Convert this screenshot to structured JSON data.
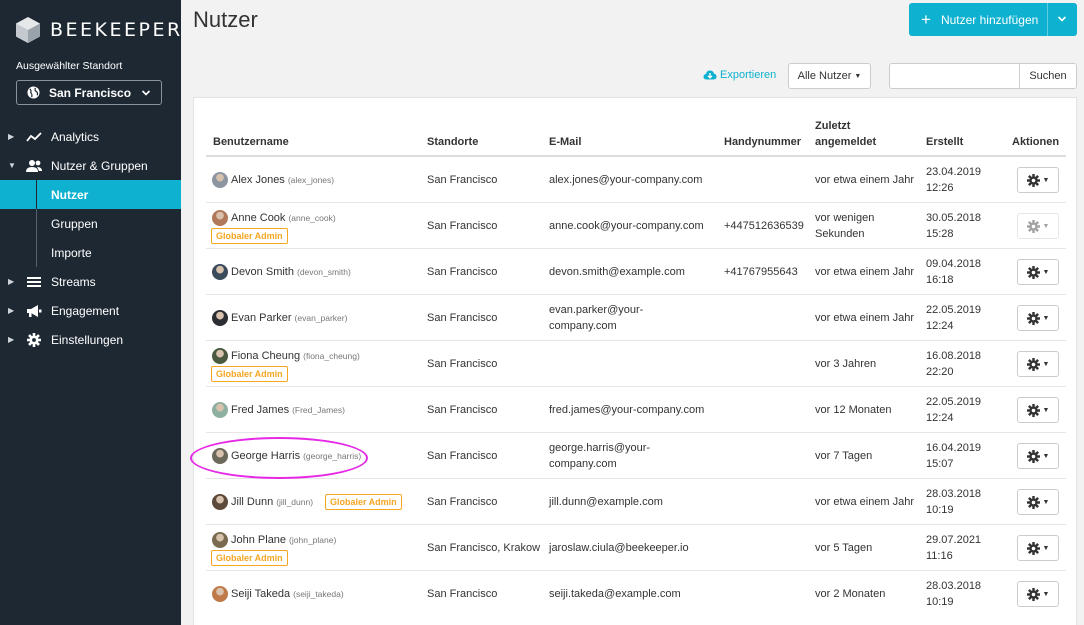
{
  "sidebar": {
    "logo_text": "BEEKEEPER",
    "location_label": "Ausgewählter Standort",
    "location_value": "San Francisco",
    "nav": {
      "analytics": "Analytics",
      "users_groups": "Nutzer & Gruppen",
      "users": "Nutzer",
      "groups": "Gruppen",
      "imports": "Importe",
      "streams": "Streams",
      "engagement": "Engagement",
      "settings": "Einstellungen"
    },
    "accent_color": "#0eb1cf",
    "background_color": "#1e2833"
  },
  "header": {
    "title": "Nutzer",
    "add_button": "Nutzer hinzufügen",
    "export": "Exportieren",
    "filter": "Alle Nutzer",
    "search_placeholder": "",
    "search_button": "Suchen"
  },
  "table": {
    "columns": {
      "username": "Benutzername",
      "locations": "Standorte",
      "email": "E-Mail",
      "phone": "Handynummer",
      "last_login_1": "Zuletzt",
      "last_login_2": "angemeldet",
      "created": "Erstellt",
      "actions": "Aktionen"
    },
    "admin_badge": "Globaler Admin",
    "rows": [
      {
        "name": "Alex Jones",
        "username": "(alex_jones)",
        "admin": false,
        "location": "San Francisco",
        "email1": "alex.jones@your-company.com",
        "email2": "",
        "phone": "",
        "last1": "vor etwa einem Jahr",
        "last2": "",
        "date": "23.04.2019",
        "time": "12:26",
        "gear_disabled": false
      },
      {
        "name": "Anne Cook",
        "username": "(anne_cook)",
        "admin": true,
        "location": "San Francisco",
        "email1": "anne.cook@your-company.com",
        "email2": "",
        "phone": "+447512636539",
        "last1": "vor wenigen",
        "last2": "Sekunden",
        "date": "30.05.2018",
        "time": "15:28",
        "gear_disabled": true
      },
      {
        "name": "Devon Smith",
        "username": "(devon_smith)",
        "admin": false,
        "location": "San Francisco",
        "email1": "devon.smith@example.com",
        "email2": "",
        "phone": "+41767955643",
        "last1": "vor etwa einem Jahr",
        "last2": "",
        "date": "09.04.2018",
        "time": "16:18",
        "gear_disabled": false
      },
      {
        "name": "Evan Parker",
        "username": "(evan_parker)",
        "admin": false,
        "location": "San Francisco",
        "email1": "evan.parker@your-",
        "email2": "company.com",
        "phone": "",
        "last1": "vor etwa einem Jahr",
        "last2": "",
        "date": "22.05.2019",
        "time": "12:24",
        "gear_disabled": false
      },
      {
        "name": "Fiona Cheung",
        "username": "(fiona_cheung)",
        "admin": true,
        "location": "San Francisco",
        "email1": "",
        "email2": "",
        "phone": "",
        "last1": "vor 3 Jahren",
        "last2": "",
        "date": "16.08.2018",
        "time": "22:20",
        "gear_disabled": false
      },
      {
        "name": "Fred James",
        "username": "(Fred_James)",
        "admin": false,
        "location": "San Francisco",
        "email1": "fred.james@your-company.com",
        "email2": "",
        "phone": "",
        "last1": "vor 12 Monaten",
        "last2": "",
        "date": "22.05.2019",
        "time": "12:24",
        "gear_disabled": false
      },
      {
        "name": "George Harris",
        "username": "(george_harris)",
        "admin": false,
        "location": "San Francisco",
        "email1": "george.harris@your-",
        "email2": "company.com",
        "phone": "",
        "last1": "vor 7 Tagen",
        "last2": "",
        "date": "16.04.2019",
        "time": "15:07",
        "gear_disabled": false
      },
      {
        "name": "Jill Dunn",
        "username": "(jill_dunn)",
        "admin": true,
        "location": "San Francisco",
        "email1": "jill.dunn@example.com",
        "email2": "",
        "phone": "",
        "last1": "vor etwa einem Jahr",
        "last2": "",
        "date": "28.03.2018",
        "time": "10:19",
        "gear_disabled": false
      },
      {
        "name": "John Plane",
        "username": "(john_plane)",
        "admin": true,
        "location": "San Francisco, Krakow",
        "email1": "jaroslaw.ciula@beekeeper.io",
        "email2": "",
        "phone": "",
        "last1": "vor 5 Tagen",
        "last2": "",
        "date": "29.07.2021",
        "time": "11:16",
        "gear_disabled": false
      },
      {
        "name": "Seiji Takeda",
        "username": "(seiji_takeda)",
        "admin": false,
        "location": "San Francisco",
        "email1": "seiji.takeda@example.com",
        "email2": "",
        "phone": "",
        "last1": "vor 2 Monaten",
        "last2": "",
        "date": "28.03.2018",
        "time": "10:19",
        "gear_disabled": false
      }
    ]
  }
}
